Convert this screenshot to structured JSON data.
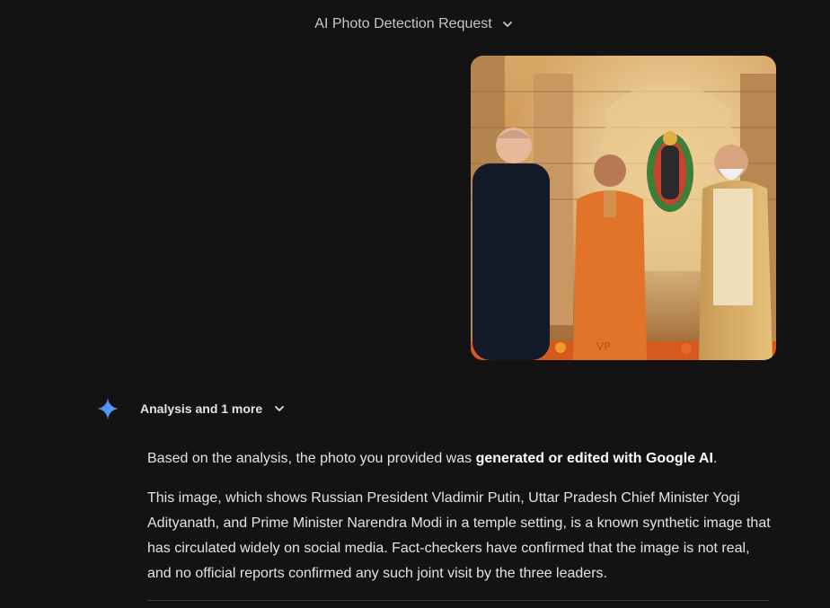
{
  "header": {
    "title": "AI Photo Detection Request",
    "chevron_icon": "chevron-down-icon"
  },
  "user_message": {
    "image_alt": "Uploaded photo of three men in a temple",
    "image_badge": "VP"
  },
  "response": {
    "icon": "gemini-sparkle-icon",
    "toggle_label": "Analysis and 1 more",
    "para1_prefix": "Based on the analysis, the photo you provided was ",
    "para1_bold": "generated or edited with Google AI",
    "para1_suffix": ".",
    "para2": "This image, which shows Russian President Vladimir Putin, Uttar Pradesh Chief Minister Yogi Adityanath, and Prime Minister Narendra Modi in a temple setting, is a known synthetic image that has circulated widely on social media. Fact-checkers have confirmed that the image is not real, and no official reports confirmed any such joint visit by the three leaders."
  },
  "colors": {
    "background": "#131314",
    "text": "#e3e3e3",
    "sparkle_blue": "#4c8df6"
  }
}
